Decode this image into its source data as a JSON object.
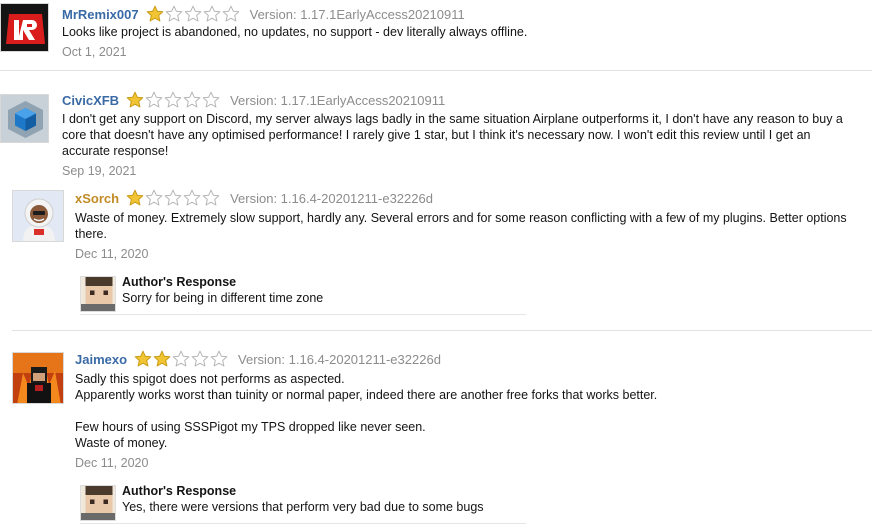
{
  "colors": {
    "username_blue": "#3a6aa6",
    "username_gold": "#c28b25",
    "star_fill": "#f0c432",
    "star_empty_stroke": "#b5b5b5",
    "meta_gray": "#8c8c8c",
    "divider": "#e2e2e2"
  },
  "reviews": [
    {
      "username": "MrRemix007",
      "rating": 1,
      "max_rating": 5,
      "version": "Version: 1.17.1EarlyAccess20210911",
      "text": "Looks like project is abandoned, no updates, no support - dev literally always offline.",
      "date": "Oct 1, 2021",
      "avatar_icon": "red-logo-avatar"
    },
    {
      "username": "CivicXFB",
      "rating": 1,
      "max_rating": 5,
      "version": "Version: 1.17.1EarlyAccess20210911",
      "text": "I don't get any support on Discord, my server always lags badly in the same situation Airplane outperforms it, I don't have any reason to buy a\ncore that doesn't have any optimised performance! I rarely give 1 star, but I think it's necessary now. I won't edit this review until I get an\naccurate response!",
      "date": "Sep 19, 2021",
      "avatar_icon": "blue-cube-avatar"
    },
    {
      "username": "xSorch",
      "rating": 1,
      "max_rating": 5,
      "version": "Version: 1.16.4-20201211-e32226d",
      "text": "Waste of money. Extremely slow support, hardly any. Several errors and for some reason conflicting with a few of my plugins. Better options\nthere.",
      "date": "Dec 11, 2020",
      "avatar_icon": "cartoon-hoodie-avatar",
      "response": {
        "title": "Author's Response",
        "text": "Sorry for being in different time zone"
      }
    },
    {
      "username": "Jaimexo",
      "rating": 2,
      "max_rating": 5,
      "version": "Version: 1.16.4-20201211-e32226d",
      "text": "Sadly this spigot does not performs as aspected.\nApparently works worst than tuinity or normal paper, indeed there are another free forks that works better.\n\nFew hours of using SSSPigot my TPS dropped like never seen.\nWaste of money.",
      "date": "Dec 11, 2020",
      "avatar_icon": "fire-character-avatar",
      "response": {
        "title": "Author's Response",
        "text": "Yes, there were versions that perform very bad due to some bugs"
      }
    }
  ]
}
